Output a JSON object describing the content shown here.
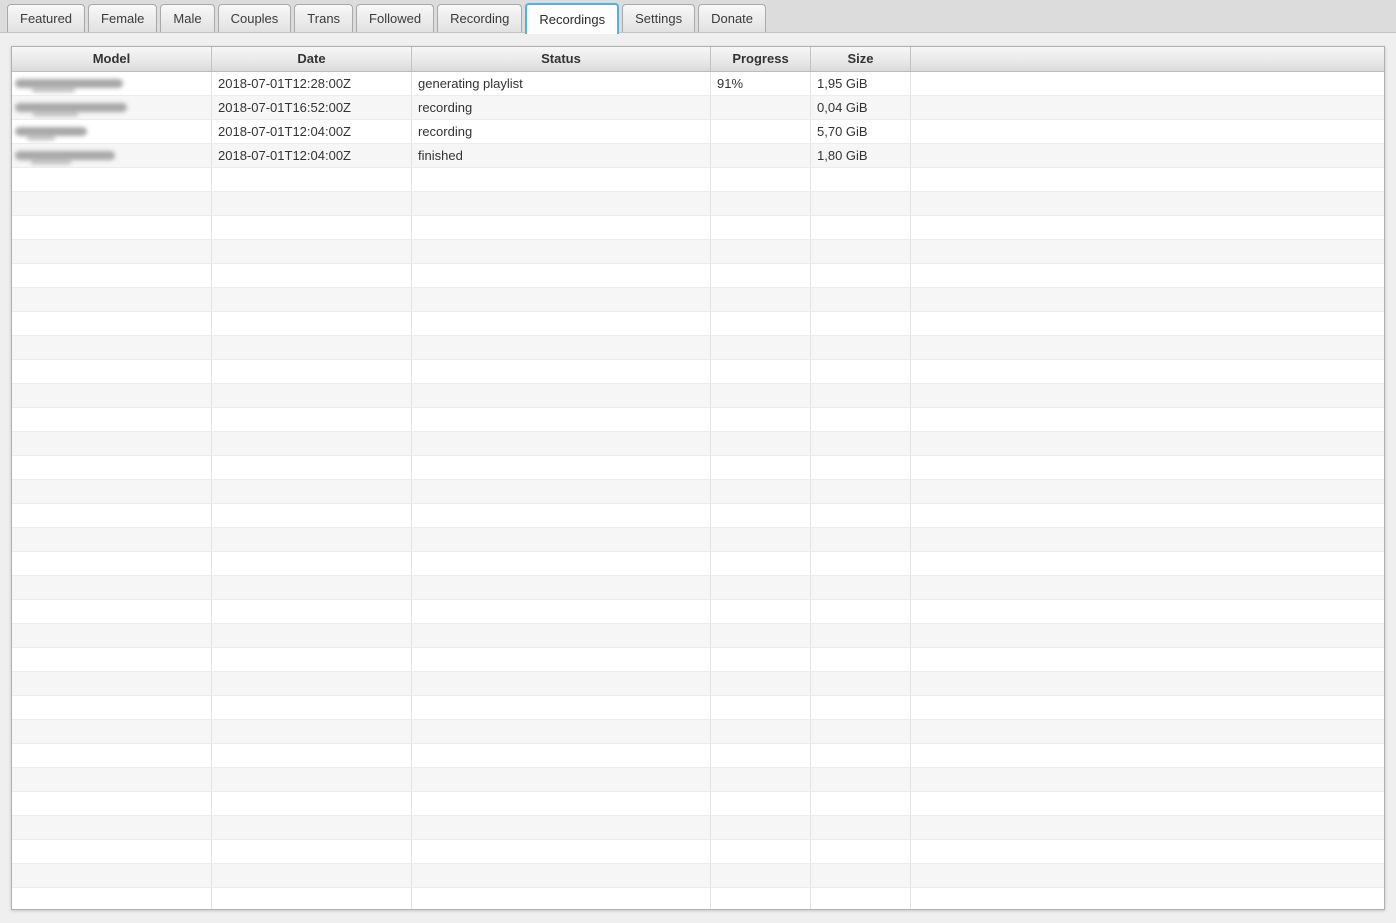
{
  "tabs": {
    "items": [
      "Featured",
      "Female",
      "Male",
      "Couples",
      "Trans",
      "Followed",
      "Recording",
      "Recordings",
      "Settings",
      "Donate"
    ],
    "active": "Recordings"
  },
  "table": {
    "columns": [
      "Model",
      "Date",
      "Status",
      "Progress",
      "Size",
      ""
    ],
    "rows": [
      {
        "model": "",
        "model_redacted": true,
        "date": "2018-07-01T12:28:00Z",
        "status": "generating playlist",
        "progress": "91%",
        "size": "1,95 GiB"
      },
      {
        "model": "",
        "model_redacted": true,
        "date": "2018-07-01T16:52:00Z",
        "status": "recording",
        "progress": "",
        "size": "0,04 GiB"
      },
      {
        "model": "",
        "model_redacted": true,
        "date": "2018-07-01T12:04:00Z",
        "status": "recording",
        "progress": "",
        "size": "5,70 GiB"
      },
      {
        "model": "",
        "model_redacted": true,
        "date": "2018-07-01T12:04:00Z",
        "status": "finished",
        "progress": "",
        "size": "1,80 GiB"
      }
    ],
    "empty_row_count": 31
  },
  "colors": {
    "active_tab_border": "#54b1dc",
    "tab_bar_background": "#dcdcdc",
    "page_background": "#efefef",
    "row_stripe": "#f6f6f6",
    "text": "#333333"
  }
}
